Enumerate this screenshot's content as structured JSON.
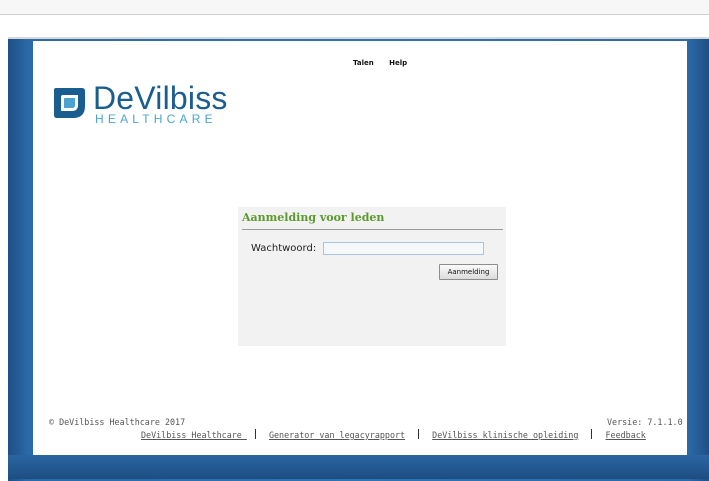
{
  "header": {
    "languages_label": "Talen",
    "help_label": "Help"
  },
  "brand": {
    "name": "DeVilbiss",
    "sub": "HEALTHCARE",
    "primary_color": "#1a5d8f",
    "secondary_color": "#4aa4cf"
  },
  "login": {
    "title": "Aanmelding voor leden",
    "password_label": "Wachtwoord:",
    "password_value": "",
    "submit_label": "Aanmelding",
    "title_color": "#5b9a2c"
  },
  "footer": {
    "copyright": "© DeVilbiss Healthcare 2017",
    "version": "Versie: 7.1.1.0",
    "links": [
      "DeVilbiss Healthcare ",
      "Generator van legacyrapport",
      "DeVilbiss klinische opleiding",
      "Feedback"
    ]
  },
  "theme": {
    "frame_color": "#2f74b5"
  }
}
